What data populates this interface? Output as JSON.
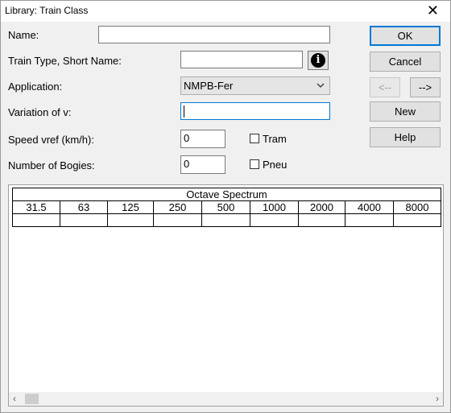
{
  "window": {
    "title": "Library: Train Class",
    "close_glyph": "✕"
  },
  "form": {
    "name": {
      "label": "Name:",
      "value": ""
    },
    "train_type": {
      "label": "Train Type, Short Name:",
      "value": "",
      "info_icon": "info-circle-icon"
    },
    "application": {
      "label": "Application:",
      "selected": "NMPB-Fer"
    },
    "variation": {
      "label": "Variation of v:",
      "value": ""
    },
    "speed": {
      "label": "Speed vref (km/h):",
      "value": "0"
    },
    "bogies": {
      "label": "Number of Bogies:",
      "value": "0"
    },
    "tram": {
      "label": "Tram",
      "checked": false
    },
    "pneu": {
      "label": "Pneu",
      "checked": false
    }
  },
  "buttons": {
    "ok": "OK",
    "cancel": "Cancel",
    "prev": "<--",
    "next": "-->",
    "new": "New",
    "help": "Help"
  },
  "spectrum": {
    "title": "Octave Spectrum",
    "bands": [
      "31.5",
      "63",
      "125",
      "250",
      "500",
      "1000",
      "2000",
      "4000",
      "8000"
    ],
    "values": [
      "",
      "",
      "",
      "",
      "",
      "",
      "",
      "",
      ""
    ]
  },
  "scrollbar": {
    "left_arrow": "‹",
    "right_arrow": "›"
  }
}
